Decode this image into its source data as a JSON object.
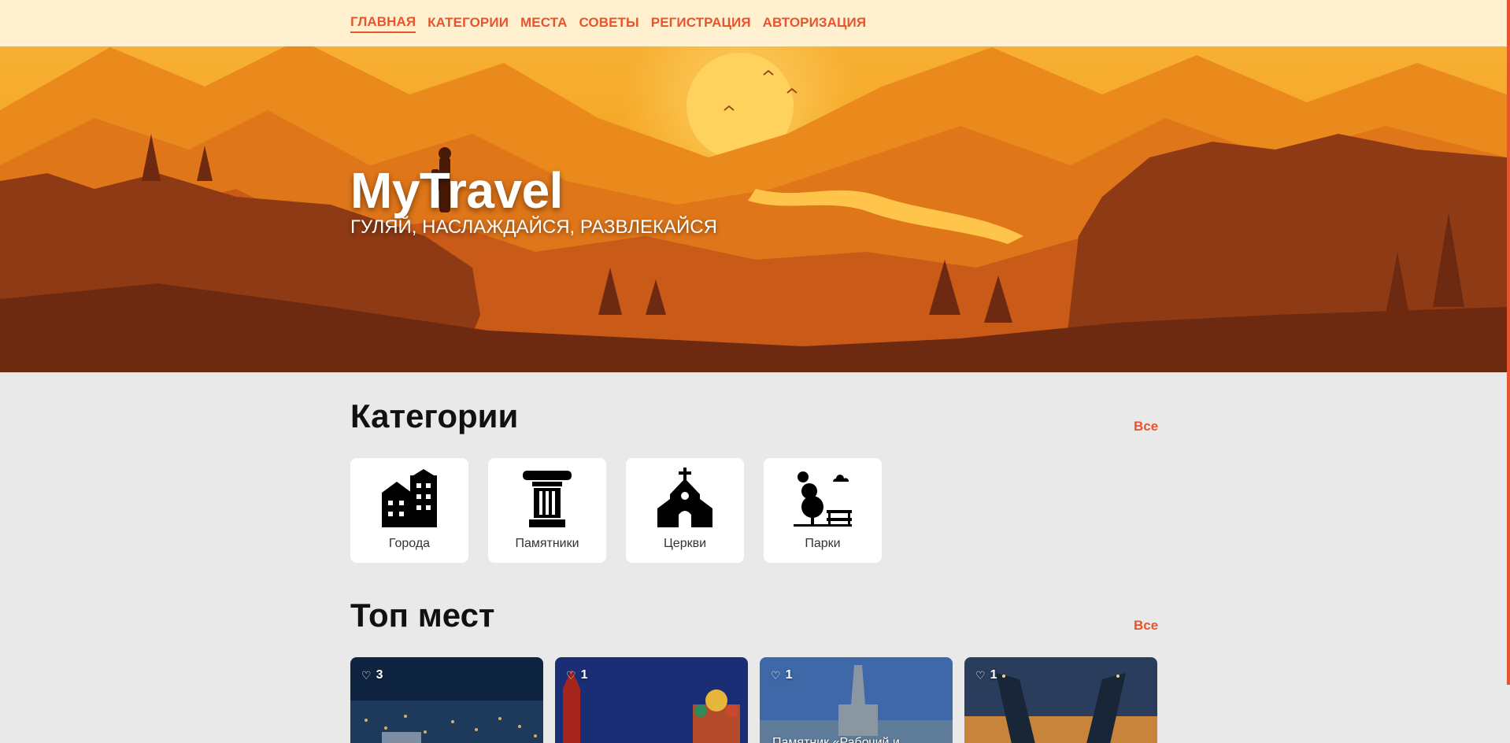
{
  "nav": {
    "items": [
      {
        "label": "ГЛАВНАЯ",
        "active": true
      },
      {
        "label": "КАТЕГОРИИ",
        "active": false
      },
      {
        "label": "МЕСТА",
        "active": false
      },
      {
        "label": "СОВЕТЫ",
        "active": false
      },
      {
        "label": "РЕГИСТРАЦИЯ",
        "active": false
      },
      {
        "label": "АВТОРИЗАЦИЯ",
        "active": false
      }
    ]
  },
  "hero": {
    "title": "MyTravel",
    "subtitle": "ГУЛЯЙ, НАСЛАЖДАЙСЯ, РАЗВЛЕКАЙСЯ"
  },
  "categories": {
    "heading": "Категории",
    "all_label": "Все",
    "items": [
      {
        "label": "Города",
        "icon": "city-buildings-icon"
      },
      {
        "label": "Памятники",
        "icon": "column-monument-icon"
      },
      {
        "label": "Церкви",
        "icon": "church-icon"
      },
      {
        "label": "Парки",
        "icon": "park-tree-bench-icon"
      }
    ]
  },
  "top_places": {
    "heading": "Топ мест",
    "all_label": "Все",
    "items": [
      {
        "likes": "3",
        "name": ""
      },
      {
        "likes": "1",
        "name": ""
      },
      {
        "likes": "1",
        "name": "Памятник «Рабочий и"
      },
      {
        "likes": "1",
        "name": ""
      }
    ]
  },
  "colors": {
    "accent": "#e8542c",
    "nav_bg": "#fff3d6",
    "page_bg": "#e9e9e9"
  }
}
